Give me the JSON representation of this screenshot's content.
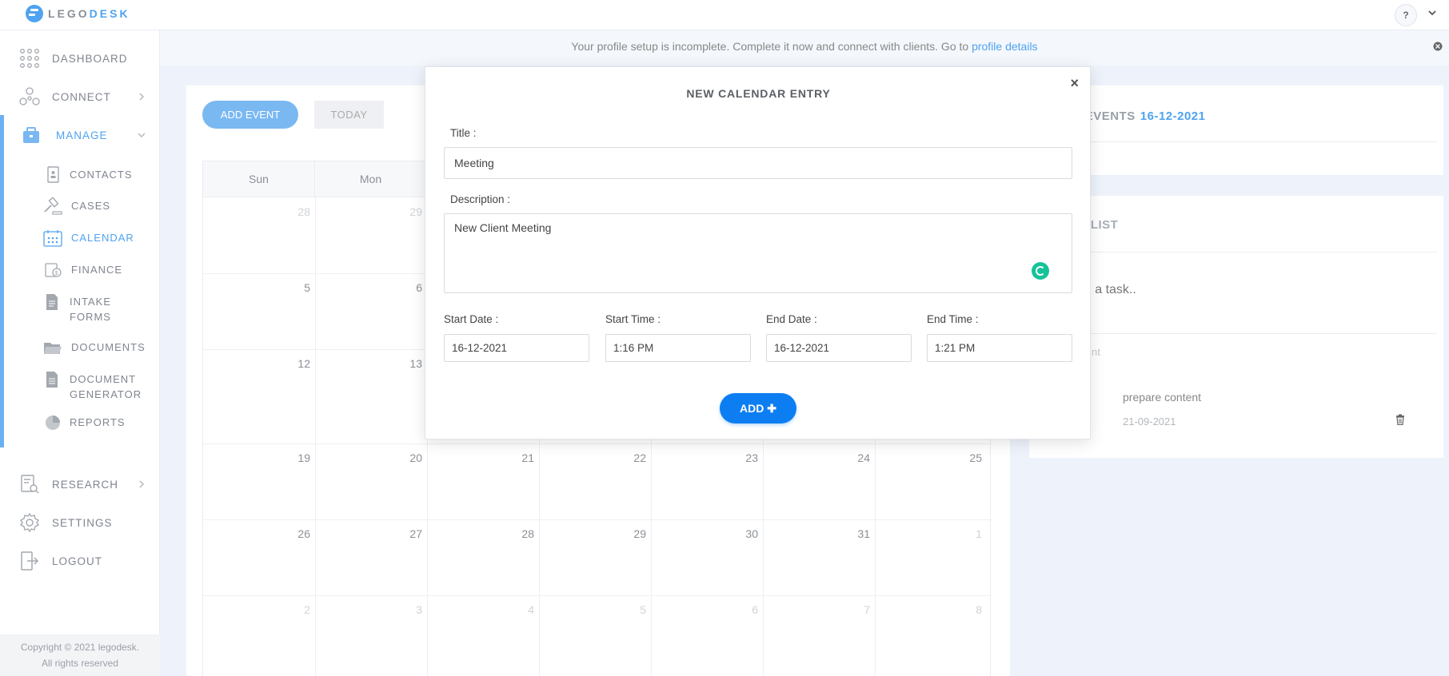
{
  "header": {
    "logo_part1": "LEGO",
    "logo_part2": "DESK",
    "help_label": "?"
  },
  "sidebar": {
    "items": [
      {
        "label": "DASHBOARD",
        "icon": "grid-icon"
      },
      {
        "label": "CONNECT",
        "icon": "network-icon"
      },
      {
        "label": "MANAGE",
        "icon": "briefcase-icon"
      },
      {
        "label": "RESEARCH",
        "icon": "research-icon"
      },
      {
        "label": "SETTINGS",
        "icon": "gear-icon"
      },
      {
        "label": "LOGOUT",
        "icon": "logout-icon"
      }
    ],
    "manage_sub": [
      {
        "label": "CONTACTS",
        "icon": "contact-card-icon"
      },
      {
        "label": "CASES",
        "icon": "gavel-icon"
      },
      {
        "label": "CALENDAR",
        "icon": "calendar-icon"
      },
      {
        "label": "FINANCE",
        "icon": "finance-icon"
      },
      {
        "label": "INTAKE",
        "label2": "FORMS",
        "icon": "form-icon"
      },
      {
        "label": "DOCUMENTS",
        "icon": "folder-icon"
      },
      {
        "label": "DOCUMENT",
        "label2": "GENERATOR",
        "icon": "document-icon"
      },
      {
        "label": "REPORTS",
        "icon": "pie-chart-icon"
      }
    ],
    "copyright_line1": "Copyright © 2021 legodesk.",
    "copyright_line2": "All rights reserved"
  },
  "banner": {
    "text": "Your profile setup is incomplete. Complete it now and connect with clients. Go to ",
    "link": "profile details"
  },
  "calendar": {
    "add_event_label": "ADD EVENT",
    "today_label": "TODAY",
    "weekdays": [
      "Sun",
      "Mon"
    ],
    "rows": [
      [
        {
          "d": "28",
          "m": true
        },
        {
          "d": "29",
          "m": true
        }
      ],
      [
        {
          "d": "5"
        },
        {
          "d": "6"
        }
      ],
      [
        {
          "d": "12"
        },
        {
          "d": "13"
        }
      ],
      [
        {
          "d": "19"
        },
        {
          "d": "20"
        },
        {
          "d": "21"
        },
        {
          "d": "22"
        },
        {
          "d": "23"
        },
        {
          "d": "24"
        },
        {
          "d": "25"
        }
      ],
      [
        {
          "d": "26"
        },
        {
          "d": "27"
        },
        {
          "d": "28"
        },
        {
          "d": "29"
        },
        {
          "d": "30"
        },
        {
          "d": "31"
        },
        {
          "d": "1",
          "m": true
        }
      ],
      [
        {
          "d": "2",
          "m": true
        },
        {
          "d": "3",
          "m": true
        },
        {
          "d": "4",
          "m": true
        },
        {
          "d": "5",
          "m": true
        },
        {
          "d": "6",
          "m": true
        },
        {
          "d": "7",
          "m": true
        },
        {
          "d": "8",
          "m": true
        }
      ]
    ]
  },
  "events_panel": {
    "title": "Y'S EVENTS",
    "date": "16-12-2021"
  },
  "todo_panel": {
    "title": "O LIST",
    "input_placeholder": "dd a task..",
    "pending_label": "nt",
    "task_title": "prepare content",
    "task_date": "21-09-2021"
  },
  "modal": {
    "title": "NEW CALENDAR ENTRY",
    "close_label": "×",
    "title_label": "Title :",
    "title_value": "Meeting",
    "description_label": "Description :",
    "description_value": "New Client Meeting",
    "start_date_label": "Start Date :",
    "start_date_value": "16-12-2021",
    "start_time_label": "Start Time :",
    "start_time_value": "1:16 PM",
    "end_date_label": "End Date :",
    "end_date_value": "16-12-2021",
    "end_time_label": "End Time :",
    "end_time_value": "1:21 PM",
    "add_label": "ADD"
  },
  "colors": {
    "accent": "#4fa3f0",
    "primary_button": "#0d7ef2",
    "grammarly": "#15c39a"
  }
}
